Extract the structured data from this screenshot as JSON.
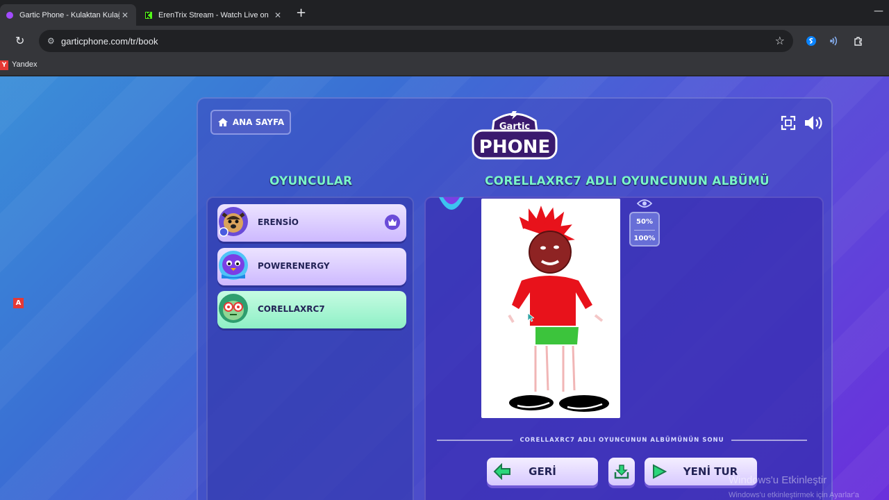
{
  "browser": {
    "tabs": [
      {
        "title": "Gartic Phone - Kulaktan Kulağa",
        "active": true
      },
      {
        "title": "ErenTrix Stream - Watch Live on",
        "active": false
      }
    ],
    "address": "garticphone.com/tr/book",
    "bookmarks": [
      {
        "icon": "Y",
        "label": "Yandex"
      }
    ]
  },
  "page": {
    "side_badge": "A",
    "home_button": "ANA SAYFA",
    "logo": {
      "line1": "Gartic",
      "line2": "PHONE"
    },
    "players_heading": "OYUNCULAR",
    "album_heading": "CORELLAXRC7 ADLI OYUNCUNUN ALBÜMÜ",
    "players": [
      {
        "name": "ERENSİO",
        "host": true
      },
      {
        "name": "POWERENERGY",
        "host": false
      },
      {
        "name": "CORELLAXRC7",
        "host": false,
        "selected": true
      }
    ],
    "zoom": {
      "option_50": "50%",
      "option_100": "100%"
    },
    "album_end": "CORELLAXRC7 ADLI OYUNCUNUN ALBÜMÜNÜN SONU",
    "back_button": "GERİ",
    "new_round_button": "YENİ TUR"
  },
  "watermark": {
    "line1": "Windows'u Etkinleştir",
    "line2": "Windows'u etkinleştirmek için Ayarlar'a"
  },
  "colors": {
    "accent_green": "#7af5c8",
    "selected_row": "#8ef0c6",
    "row_lilac": "#cdb9ff",
    "crown": "#6a4bd8"
  }
}
